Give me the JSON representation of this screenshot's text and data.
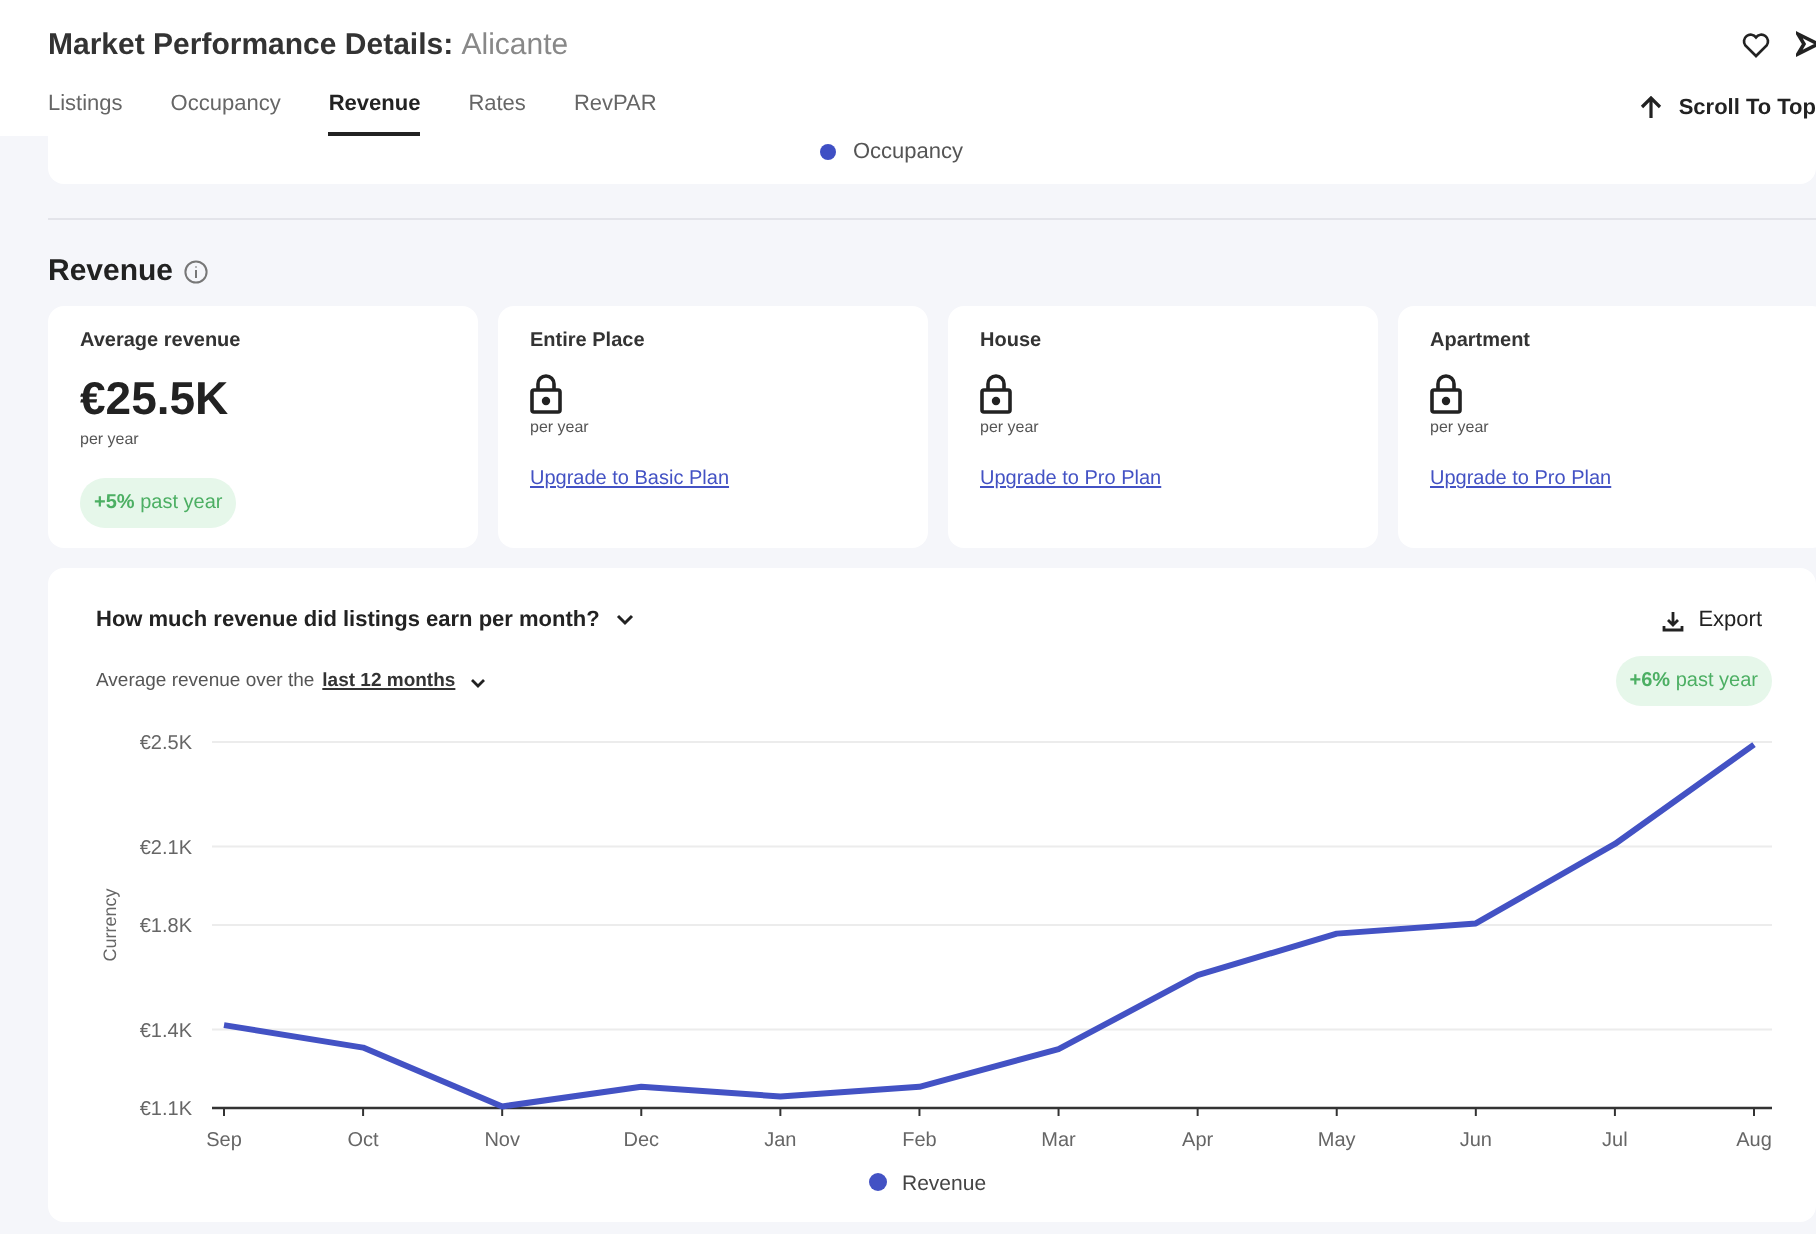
{
  "header": {
    "title": "Market Performance Details:",
    "location": "Alicante",
    "scroll_to_top": "Scroll To Top"
  },
  "tabs": [
    {
      "label": "Listings",
      "selected": false
    },
    {
      "label": "Occupancy",
      "selected": false
    },
    {
      "label": "Revenue",
      "selected": true
    },
    {
      "label": "Rates",
      "selected": false
    },
    {
      "label": "RevPAR",
      "selected": false
    }
  ],
  "previous_chart": {
    "legend": [
      {
        "name": "Occupancy",
        "color": "#3f4fc4"
      }
    ]
  },
  "section": {
    "title": "Revenue"
  },
  "cards": [
    {
      "kind": "value",
      "title": "Average revenue",
      "value": "€25.5K",
      "period": "per year",
      "badge": "**+5%** past year"
    },
    {
      "kind": "locked",
      "title": "Entire Place",
      "period": "per year",
      "link": "Upgrade to Basic Plan"
    },
    {
      "kind": "locked",
      "title": "House",
      "period": "per year",
      "link": "Upgrade to Pro Plan"
    },
    {
      "kind": "locked",
      "title": "Apartment",
      "period": "per year",
      "link": "Upgrade to Pro Plan"
    }
  ],
  "chart_panel": {
    "question": "How much revenue did listings earn per month?",
    "export": "Export",
    "subtitle_prefix": "Average revenue over the",
    "period": "last 12 months",
    "badge": "**+6%** past year",
    "chart_data": {
      "type": "line",
      "ylabel": "Currency",
      "categories": [
        "Sep",
        "Oct",
        "Nov",
        "Dec",
        "Jan",
        "Feb",
        "Mar",
        "Apr",
        "May",
        "Jun",
        "Jul",
        "Aug"
      ],
      "series": [
        {
          "name": "Revenue",
          "color": "#4352c4",
          "values": [
            1417,
            1331,
            1106,
            1181,
            1144,
            1181,
            1325,
            1608,
            1767,
            1806,
            2110,
            2490
          ]
        }
      ],
      "ylim": [
        1100,
        2500
      ],
      "grid": true,
      "yticks": [
        {
          "value": 1100,
          "label": "€1.1K"
        },
        {
          "value": 1400,
          "label": "€1.4K"
        },
        {
          "value": 1800,
          "label": "€1.8K"
        },
        {
          "value": 2100,
          "label": "€2.1K"
        },
        {
          "value": 2500,
          "label": "€2.5K"
        }
      ]
    }
  }
}
